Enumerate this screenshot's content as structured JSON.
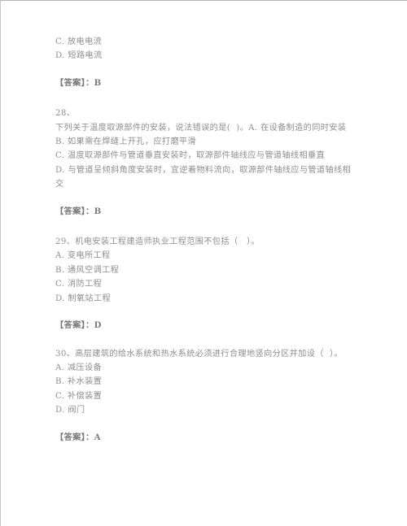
{
  "document": {
    "type": "exam-question-sheet",
    "language": "zh-CN",
    "text_color": "#8e8e8e",
    "background_color": "#ffffff",
    "border_color": "#b4b4b4"
  },
  "carryover_question": {
    "options": [
      "C. 放电电流",
      "D. 短路电流"
    ],
    "answer": "【答案】：B"
  },
  "questions": [
    {
      "number": "28、",
      "stem": "下列关于温度取源部件的安装，说法错误的是(  )。A. 在设备制造的同时安装",
      "options": [
        "B. 如果需在焊缝上开孔，应打磨平滑",
        "C. 温度取源部件与管道垂直安装时，取源部件轴线应与管道轴线相垂直",
        "D. 与管道呈倾斜角度安装时，宜逆着物料流向，取源部件轴线应与管道轴线相交"
      ],
      "answer": "【答案】：B"
    },
    {
      "number": "29、",
      "stem": "机电安装工程建造师执业工程范围不包括（　）。",
      "options": [
        "A. 变电所工程",
        "B. 通风空调工程",
        "C. 消防工程",
        "D. 制氧站工程"
      ],
      "answer": "【答案】：D"
    },
    {
      "number": "30、",
      "stem": "高层建筑的给水系统和热水系统必须进行合理地竖向分区并加设（  ）。",
      "options": [
        "A. 减压设备",
        "B. 补水装置",
        "C. 补偿装置",
        "D. 阀门"
      ],
      "answer": "【答案】：A"
    }
  ]
}
